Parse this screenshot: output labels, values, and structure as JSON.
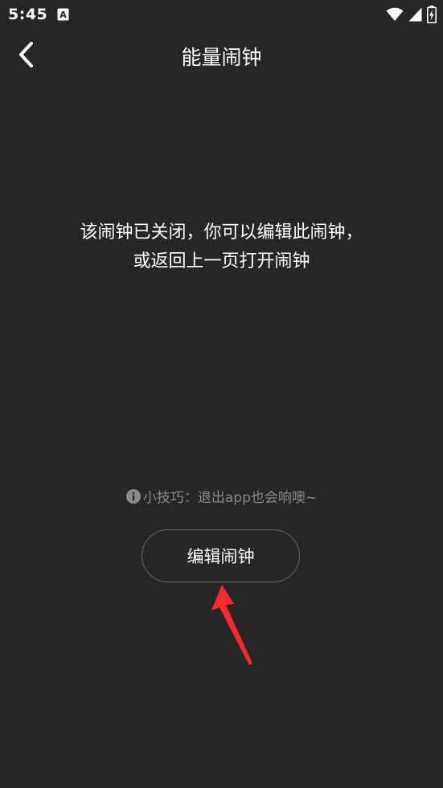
{
  "status_bar": {
    "time": "5:45",
    "notification_icon": "font-a-icon",
    "icons": [
      "wifi-icon",
      "signal-icon",
      "battery-icon"
    ]
  },
  "nav": {
    "back_icon": "chevron-left-icon",
    "title": "能量闹钟"
  },
  "content": {
    "message": "该闹钟已关闭，你可以编辑此闹钟，或返回上一页打开闹钟",
    "tip_icon": "info-icon",
    "tip_text": "小技巧：退出app也会响噢~",
    "edit_button_label": "编辑闹钟"
  },
  "annotation": {
    "arrow_color": "#ff2a2a"
  },
  "colors": {
    "background": "#262626",
    "text": "#ffffff",
    "muted_text": "#8a8a8a",
    "button_border": "#666666"
  }
}
